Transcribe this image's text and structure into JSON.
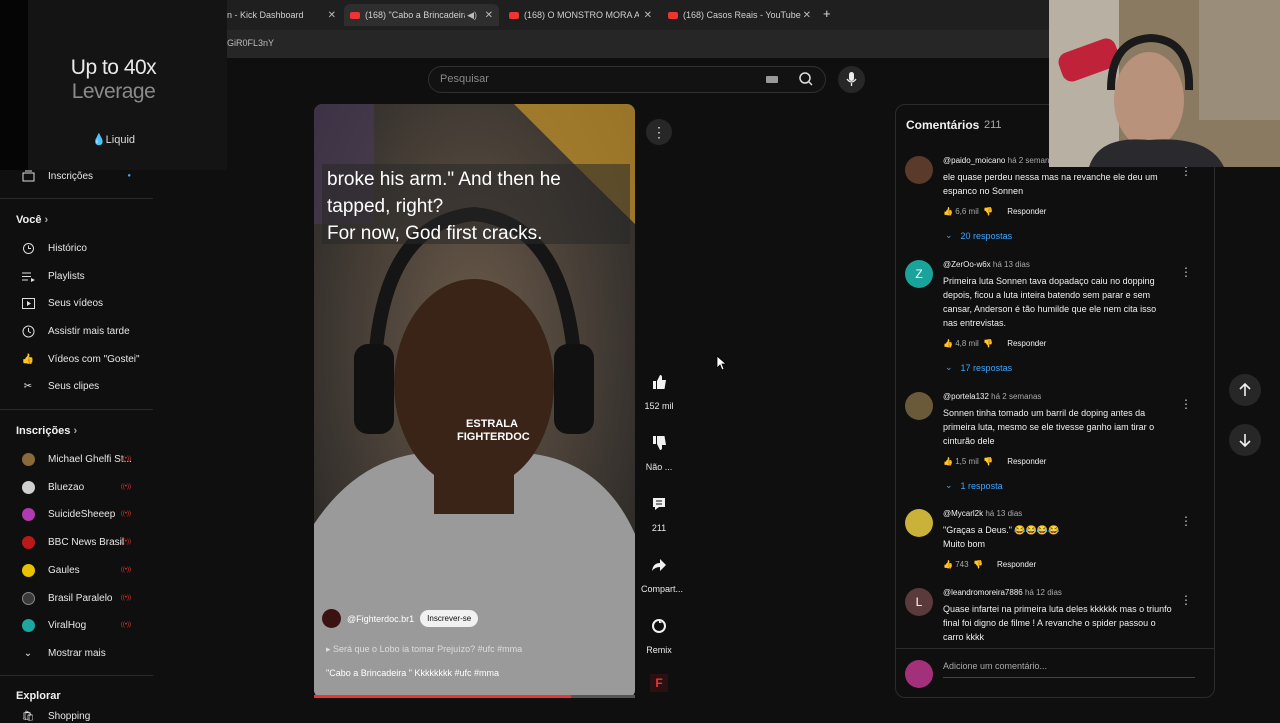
{
  "browser": {
    "tabs": [
      {
        "label": "n - Kick Dashboard",
        "close": "✕"
      },
      {
        "label": "(168) \"Cabo a Brincadeira \"",
        "close": "✕"
      },
      {
        "label": "(168) O MONSTRO MORA AO L",
        "close": "✕"
      },
      {
        "label": "(168) Casos Reais - YouTube",
        "close": "✕"
      }
    ],
    "new_tab": "+",
    "url": "GiR0FL3nY"
  },
  "ad": {
    "line1": "Up to 40x",
    "line2": "Leverage",
    "brand": "Liquid"
  },
  "search": {
    "placeholder": "Pesquisar"
  },
  "sidebar": {
    "top_item": "Inscrições",
    "you_heading": "Você",
    "you_items": [
      {
        "label": "Histórico",
        "icon": "history-icon"
      },
      {
        "label": "Playlists",
        "icon": "playlists-icon"
      },
      {
        "label": "Seus vídeos",
        "icon": "your-videos-icon"
      },
      {
        "label": "Assistir mais tarde",
        "icon": "watch-later-icon"
      },
      {
        "label": "Vídeos com \"Gostei\"",
        "icon": "like-icon"
      },
      {
        "label": "Seus clipes",
        "icon": "clips-icon"
      }
    ],
    "subs_heading": "Inscrições",
    "subs": [
      {
        "label": "Michael Ghelfi St...",
        "color": "#8a6a3a"
      },
      {
        "label": "Bluezao",
        "color": "#cfcfcf"
      },
      {
        "label": "SuicideSheeep",
        "color": "#b03ab0"
      },
      {
        "label": "BBC News Brasil",
        "color": "#bb1919"
      },
      {
        "label": "Gaules",
        "color": "#e6c200"
      },
      {
        "label": "Brasil Paralelo",
        "color": "#222222"
      },
      {
        "label": "ViralHog",
        "color": "#1aa8a0"
      }
    ],
    "show_more": "Mostrar mais",
    "explore_heading": "Explorar",
    "shopping": "Shopping"
  },
  "video": {
    "caption": "broke his arm.\" And then he tapped, right?\nFor now, God first  cracks.",
    "watermark_line1": "ESTRALA",
    "watermark_line2": "FIGHTERDOC",
    "channel": "@Fighterdoc.br1",
    "subscribe": "Inscrever-se",
    "link_text": "Será que o Lobo ia tomar Prejuízo? #ufc #mma",
    "title_text": "\"Cabo a Brincadeira \" Kkkkkkkk #ufc #mma",
    "progress": 0.8
  },
  "actions": {
    "likes": "152 mil",
    "dislike": "Não ...",
    "comments": "211",
    "share": "Compart...",
    "remix": "Remix"
  },
  "comments": {
    "title": "Comentários",
    "count": "211",
    "reply_label": "Responder",
    "add_placeholder": "Adicione um comentário...",
    "items": [
      {
        "author": "@paido_moicano",
        "time": "há 2 semanas",
        "text": "ele quase perdeu nessa mas na revanche ele deu um espanco no Sonnen",
        "likes": "6,6 mil",
        "replies": "20 respostas",
        "avatar_letter": "",
        "avatar_color": "#5a3a2a"
      },
      {
        "author": "@ZerOo-w6x",
        "time": "há 13 dias",
        "text": "Primeira luta Sonnen tava dopadaço caiu no dopping depois, ficou a luta inteira batendo sem parar e sem cansar, Anderson é tão humilde que ele nem cita isso nas entrevistas.",
        "likes": "4,8 mil",
        "replies": "17 respostas",
        "avatar_letter": "Z",
        "avatar_color": "#1aa39a"
      },
      {
        "author": "@portela132",
        "time": "há 2 semanas",
        "text": "Sonnen tinha tomado um barril de doping antes da primeira luta, mesmo se ele tivesse ganho iam tirar o cinturão dele",
        "likes": "1,5 mil",
        "replies": "1 resposta",
        "avatar_letter": "",
        "avatar_color": "#6b5a3a"
      },
      {
        "author": "@Mycarl2k",
        "time": "há 13 dias",
        "text": "\"Graças a Deus.\" 😂😂😂😂\n Muito bom",
        "likes": "743",
        "replies": "",
        "avatar_letter": "",
        "avatar_color": "#c9b13a"
      },
      {
        "author": "@leandromoreira7886",
        "time": "há 12 dias",
        "text": "Quase infartei na primeira luta deles kkkkkk mas o triunfo final foi digno de filme ! A revanche o spider passou o carro kkkk",
        "likes": "",
        "replies": "",
        "avatar_letter": "L",
        "avatar_color": "#5a3a3a"
      }
    ]
  }
}
